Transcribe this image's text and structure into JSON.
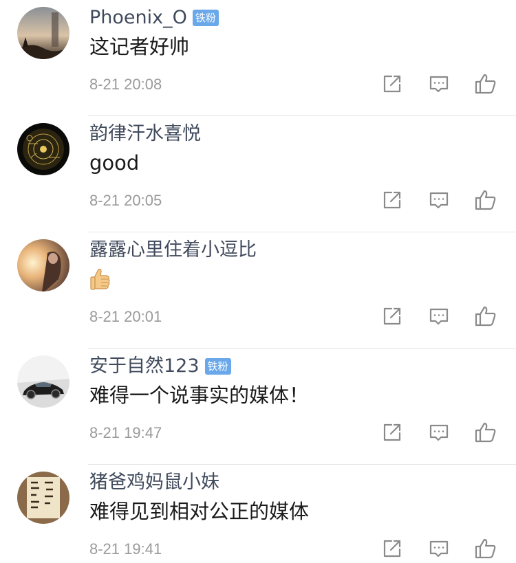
{
  "comments": [
    {
      "username": "Phoenix_O",
      "badge": "铁粉",
      "content": "这记者好帅",
      "time": "8-21 20:08"
    },
    {
      "username": "韵律汗水喜悦",
      "badge": "",
      "content": "good",
      "time": "8-21 20:05"
    },
    {
      "username": "露露心里住着小逗比",
      "badge": "",
      "content": "",
      "content_emoji": "thumbs-up",
      "time": "8-21 20:01"
    },
    {
      "username": "安于自然123",
      "badge": "铁粉",
      "content": "难得一个说事实的媒体！",
      "time": "8-21 19:47"
    },
    {
      "username": "猪爸鸡妈鼠小妹",
      "badge": "",
      "content": "难得见到相对公正的媒体",
      "time": "8-21 19:41"
    }
  ],
  "icons": {
    "share": "share-icon",
    "reply": "comment-icon",
    "like": "thumbs-up-icon"
  },
  "colors": {
    "username": "#404a5c",
    "badge": "#6aa8ea",
    "timestamp": "#9a9a9a",
    "icon": "#8a8a8a",
    "divider": "#e3e3e3"
  }
}
